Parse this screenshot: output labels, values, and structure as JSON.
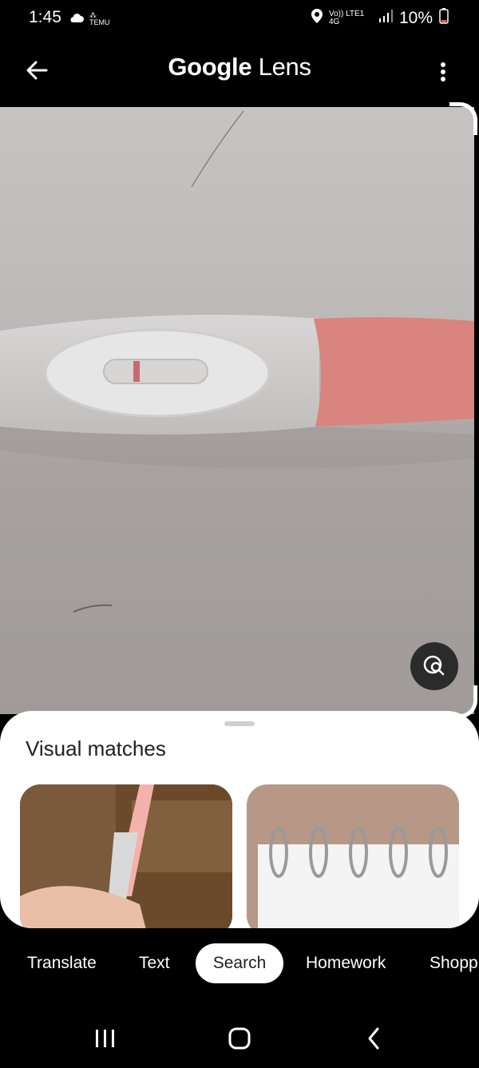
{
  "status_bar": {
    "time": "1:45",
    "network": "Vo)) LTE1 4G",
    "battery_percent": "10%",
    "icons": [
      "cloud-icon",
      "temu-notification-icon",
      "location-icon",
      "signal-icon",
      "battery-low-icon"
    ]
  },
  "top_bar": {
    "title_google": "Google",
    "title_lens": "Lens",
    "back_icon": "arrow-left-icon",
    "more_icon": "more-vert-icon"
  },
  "photo": {
    "description_icon": "lens-search-icon",
    "accent": "#e08a86"
  },
  "sheet": {
    "title": "Visual matches"
  },
  "mode_tabs": {
    "translate": "Translate",
    "text": "Text",
    "search": "Search",
    "homework": "Homework",
    "shopping": "Shopp"
  },
  "nav_bar": {
    "icons": [
      "recents-icon",
      "home-icon",
      "back-icon"
    ]
  }
}
